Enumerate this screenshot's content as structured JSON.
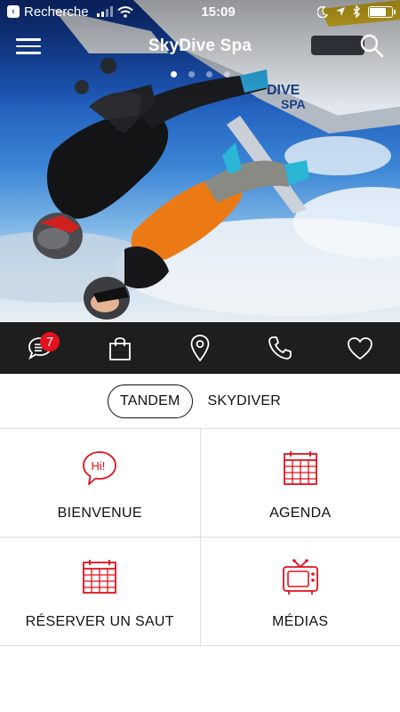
{
  "status_bar": {
    "back_label": "Recherche",
    "time": "15:09"
  },
  "header": {
    "title": "SkyDive Spa"
  },
  "carousel": {
    "page_count": 4,
    "active_index": 0,
    "plane_text": [
      "DIVE",
      "SPA"
    ]
  },
  "icon_bar": {
    "items": [
      {
        "icon": "chat-icon",
        "badge": "7"
      },
      {
        "icon": "shopping-bag-icon"
      },
      {
        "icon": "map-pin-icon"
      },
      {
        "icon": "phone-icon"
      },
      {
        "icon": "heart-icon"
      }
    ]
  },
  "segment": {
    "options": [
      "TANDEM",
      "SKYDIVER"
    ],
    "selected": "TANDEM"
  },
  "menu_grid": [
    {
      "label": "BIENVENUE",
      "icon": "hi-speech-bubble-icon"
    },
    {
      "label": "AGENDA",
      "icon": "calendar-icon"
    },
    {
      "label": "RÉSERVER UN SAUT",
      "icon": "calendar-icon"
    },
    {
      "label": "MÉDIAS",
      "icon": "tv-icon"
    }
  ],
  "colors": {
    "accent_red": "#e2111c",
    "icon_bar_bg": "#1e1e1e"
  }
}
